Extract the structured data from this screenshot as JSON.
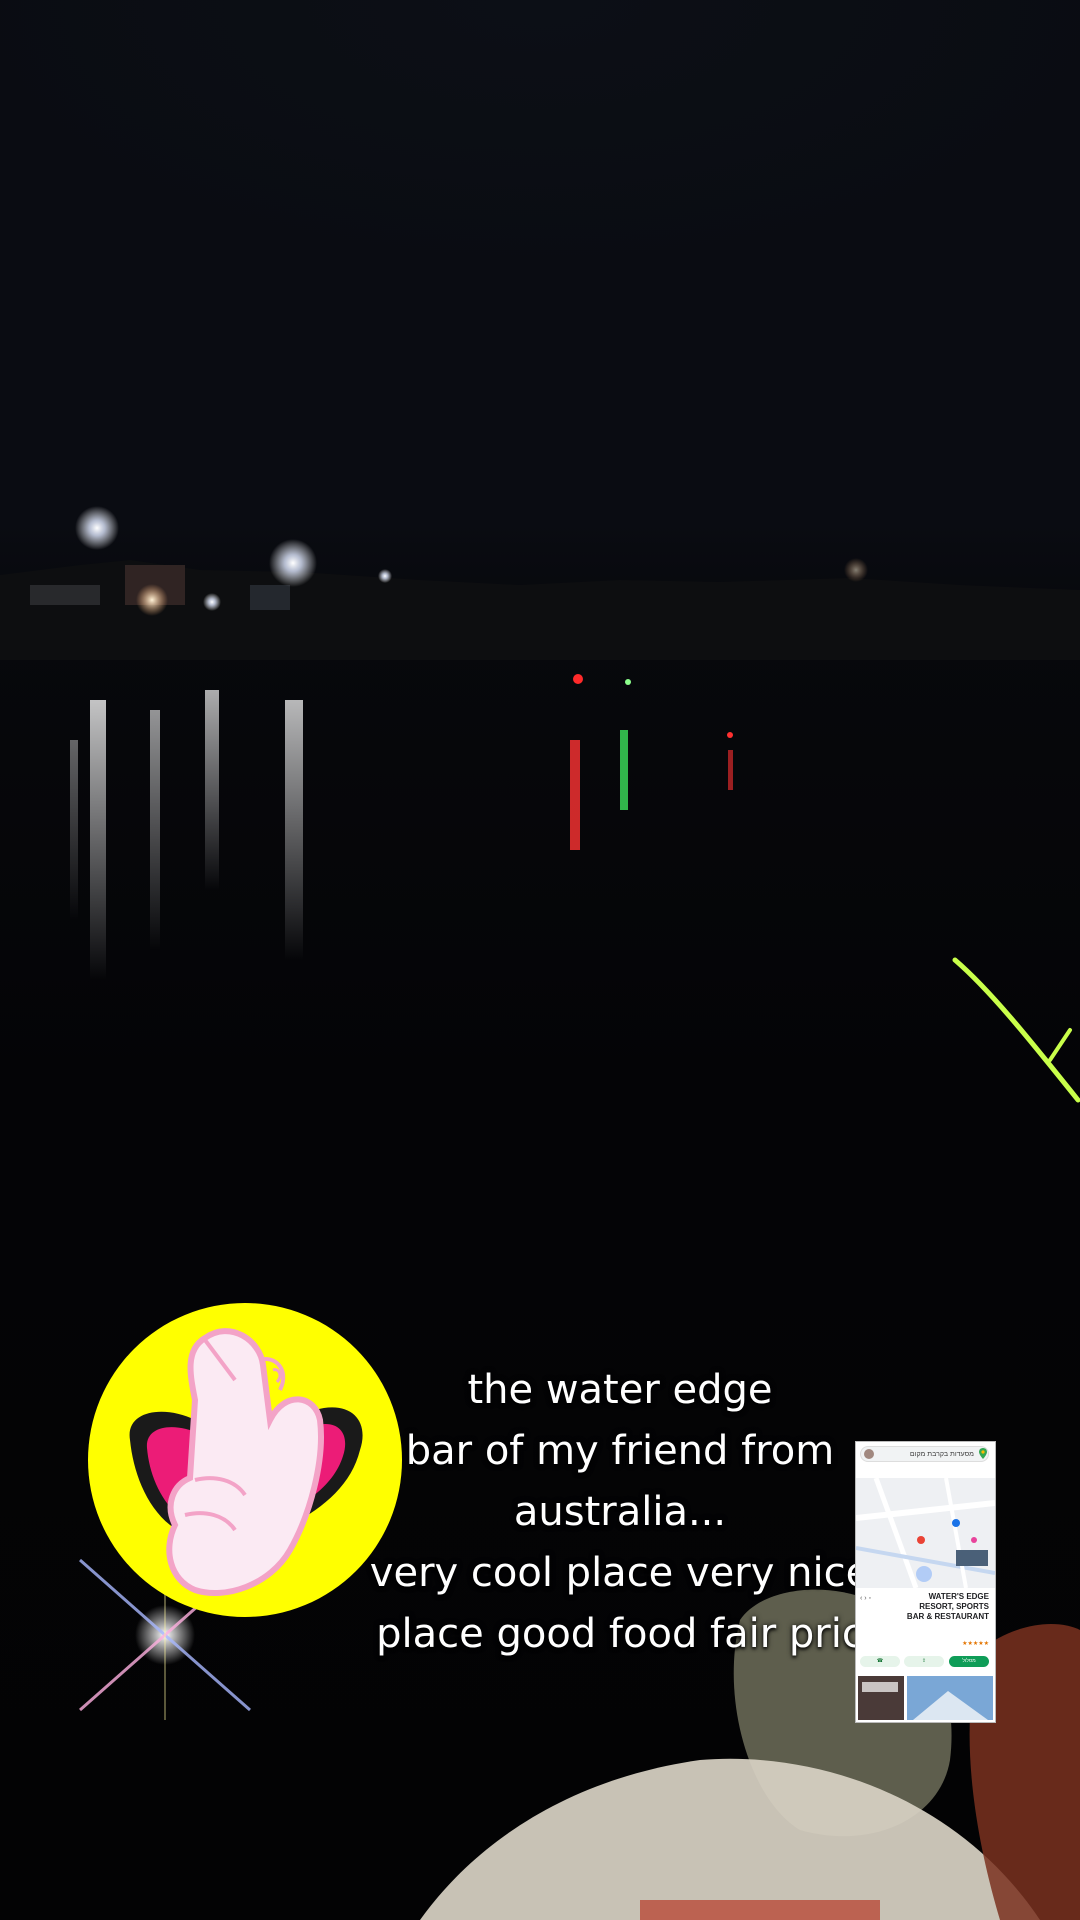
{
  "caption": {
    "lines": [
      "the water edge",
      "bar of my friend from",
      "australia...",
      "very cool place very nice",
      "place good food fair pric"
    ]
  },
  "sticker": {
    "icon": "finger-heart-emoji-icon",
    "color": "#ffff00"
  },
  "map_thumbnail": {
    "search_text": "מסעדות בקרבת מקום",
    "place_name": "WATER'S EDGE RESORT, SPORTS BAR & RESTAURANT",
    "rating_stars": "★★★★★",
    "action_label": "מסלול"
  },
  "colors": {
    "caption": "#ffffff",
    "accent_green": "#0f9d58"
  }
}
